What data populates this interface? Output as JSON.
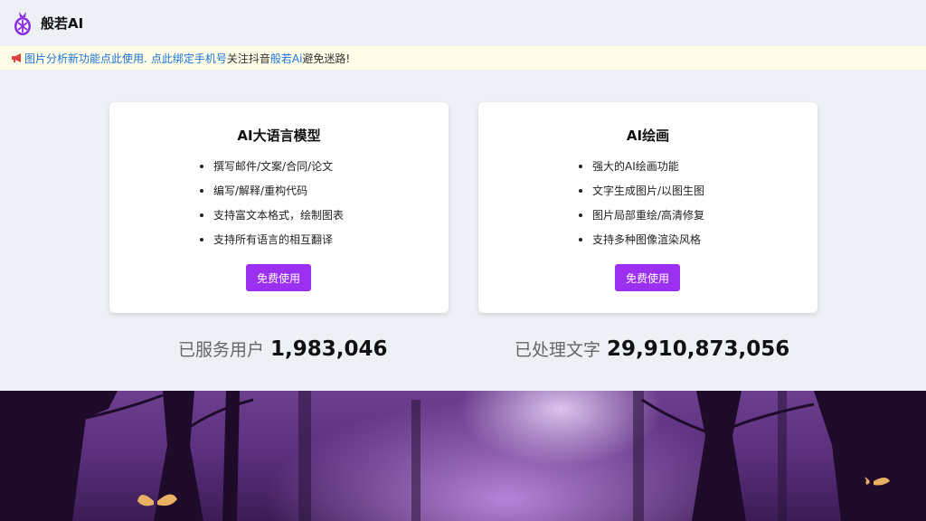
{
  "header": {
    "brand": "般若AI",
    "logo_icon": "pineapple-logo-icon",
    "accent_color": "#9b30f0"
  },
  "notice": {
    "icon": "megaphone-icon",
    "link1": "图片分析新功能点此使用.",
    "link2": "点此绑定手机号",
    "text1": "关注抖音",
    "link3": "般若Ai",
    "text2": "避免迷路!"
  },
  "cards": [
    {
      "title": "AI大语言模型",
      "features": [
        "撰写邮件/文案/合同/论文",
        "编写/解释/重构代码",
        "支持富文本格式，绘制图表",
        "支持所有语言的相互翻译"
      ],
      "button": "免费使用"
    },
    {
      "title": "AI绘画",
      "features": [
        "强大的AI绘画功能",
        "文字生成图片/以图生图",
        "图片局部重绘/高清修复",
        "支持多种图像渲染风格"
      ],
      "button": "免费使用"
    }
  ],
  "stats": [
    {
      "label": "已服务用户",
      "value": "1,983,046"
    },
    {
      "label": "已处理文字",
      "value": "29,910,873,056"
    }
  ]
}
